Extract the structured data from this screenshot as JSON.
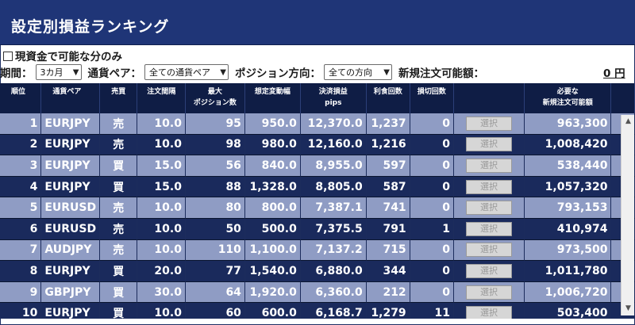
{
  "title": "設定別損益ランキング",
  "option_cash_only": "現資金で可能な分のみ",
  "filters": {
    "period_label": "期間：",
    "period_value": "3カ月",
    "pair_label": "通貨ペア：",
    "pair_value": "全ての通貨ペア",
    "direction_label": "ポジション方向：",
    "direction_value": "全ての方向",
    "available_label": "新規注文可能額：",
    "available_value": "0 円"
  },
  "columns": {
    "rank": "順位",
    "pair": "通貨ペア",
    "side": "売買",
    "interval": "注文間隔",
    "max_pos_1": "最大",
    "max_pos_2": "ポジション数",
    "range": "想定変動幅",
    "pips_1": "決済損益",
    "pips_2": "pips",
    "profit_count": "利食回数",
    "loss_count": "損切回数",
    "select": "",
    "required_1": "必要な",
    "required_2": "新規注文可能額"
  },
  "select_label": "選択",
  "rows": [
    {
      "rank": "1",
      "pair": "EURJPY",
      "side": "売",
      "interval": "10.0",
      "max_pos": "95",
      "range": "950.0",
      "pips": "12,370.0",
      "profit": "1,237",
      "loss": "0",
      "required": "963,300"
    },
    {
      "rank": "2",
      "pair": "EURJPY",
      "side": "売",
      "interval": "10.0",
      "max_pos": "98",
      "range": "980.0",
      "pips": "12,160.0",
      "profit": "1,216",
      "loss": "0",
      "required": "1,008,420"
    },
    {
      "rank": "3",
      "pair": "EURJPY",
      "side": "買",
      "interval": "15.0",
      "max_pos": "56",
      "range": "840.0",
      "pips": "8,955.0",
      "profit": "597",
      "loss": "0",
      "required": "538,440"
    },
    {
      "rank": "4",
      "pair": "EURJPY",
      "side": "買",
      "interval": "15.0",
      "max_pos": "88",
      "range": "1,328.0",
      "pips": "8,805.0",
      "profit": "587",
      "loss": "0",
      "required": "1,057,320"
    },
    {
      "rank": "5",
      "pair": "EURUSD",
      "side": "売",
      "interval": "10.0",
      "max_pos": "80",
      "range": "800.0",
      "pips": "7,387.1",
      "profit": "741",
      "loss": "0",
      "required": "793,153"
    },
    {
      "rank": "6",
      "pair": "EURUSD",
      "side": "売",
      "interval": "10.0",
      "max_pos": "50",
      "range": "500.0",
      "pips": "7,375.5",
      "profit": "791",
      "loss": "1",
      "required": "410,974"
    },
    {
      "rank": "7",
      "pair": "AUDJPY",
      "side": "売",
      "interval": "10.0",
      "max_pos": "110",
      "range": "1,100.0",
      "pips": "7,137.2",
      "profit": "715",
      "loss": "0",
      "required": "973,500"
    },
    {
      "rank": "8",
      "pair": "EURJPY",
      "side": "買",
      "interval": "20.0",
      "max_pos": "77",
      "range": "1,540.0",
      "pips": "6,880.0",
      "profit": "344",
      "loss": "0",
      "required": "1,011,780"
    },
    {
      "rank": "9",
      "pair": "GBPJPY",
      "side": "買",
      "interval": "30.0",
      "max_pos": "64",
      "range": "1,920.0",
      "pips": "6,360.0",
      "profit": "212",
      "loss": "0",
      "required": "1,006,720"
    },
    {
      "rank": "10",
      "pair": "EURJPY",
      "side": "買",
      "interval": "10.0",
      "max_pos": "60",
      "range": "600.0",
      "pips": "6,168.7",
      "profit": "1,279",
      "loss": "11",
      "required": "503,400"
    }
  ],
  "icons": {
    "checkbox": "checkbox-icon",
    "dropdown": "chevron-down-icon",
    "scroll_up": "scroll-up-icon",
    "scroll_down": "scroll-down-icon"
  },
  "colors": {
    "header_bg": "#1f3577",
    "row_odd": "#8f9cc4",
    "row_even": "#1a2a5c"
  }
}
